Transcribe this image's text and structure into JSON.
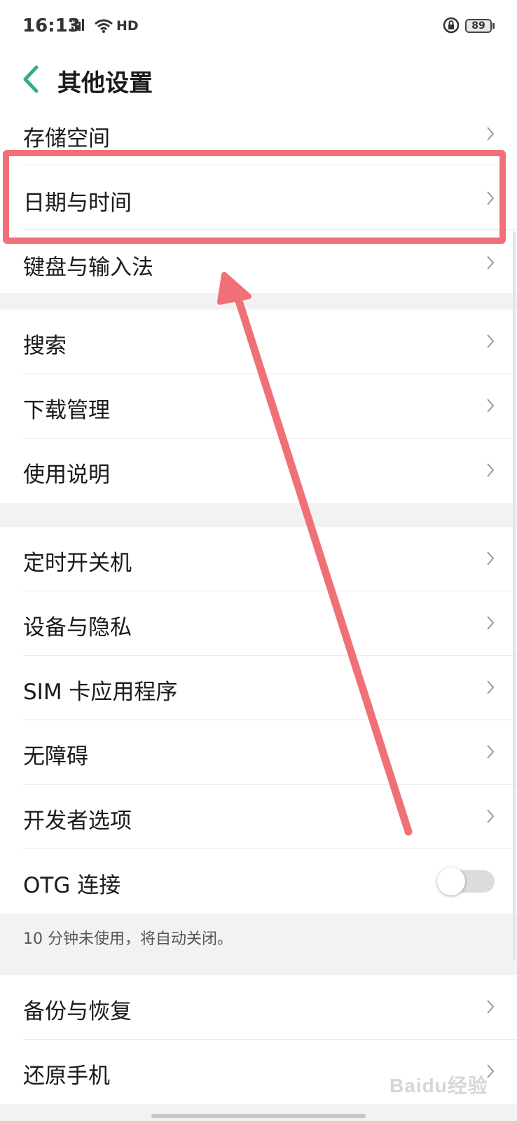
{
  "status": {
    "time": "16:13",
    "network": "4G",
    "hd": "HD",
    "battery": "89"
  },
  "header": {
    "title": "其他设置",
    "back_icon": "chevron-left",
    "accent": "#2fb37a"
  },
  "groups": [
    {
      "items": [
        {
          "label": "存储空间"
        },
        {
          "label": "日期与时间"
        },
        {
          "label": "键盘与输入法"
        }
      ]
    },
    {
      "items": [
        {
          "label": "搜索"
        },
        {
          "label": "下载管理"
        },
        {
          "label": "使用说明"
        }
      ]
    },
    {
      "items": [
        {
          "label": "定时开关机"
        },
        {
          "label": "设备与隐私"
        },
        {
          "label": "SIM 卡应用程序"
        },
        {
          "label": "无障碍"
        },
        {
          "label": "开发者选项"
        },
        {
          "label": "OTG 连接",
          "toggle": false
        }
      ]
    },
    {
      "items": [
        {
          "label": "备份与恢复"
        },
        {
          "label": "还原手机"
        }
      ]
    }
  ],
  "otg_note": "10 分钟未使用，将自动关闭。",
  "annotation": {
    "color": "#f07078"
  },
  "watermark": "Baidu经验"
}
